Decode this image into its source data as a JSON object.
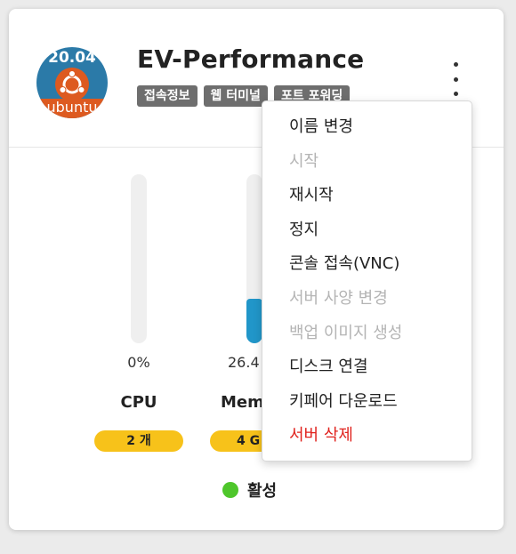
{
  "server": {
    "name": "EV-Performance",
    "os_version": "20.04",
    "os_name": "ubuntu",
    "tags": [
      "접속정보",
      "웹 터미널",
      "포트 포워딩"
    ]
  },
  "metrics": [
    {
      "name": "CPU",
      "percent_text": "0%",
      "usage": 0.0,
      "spec": "2 개"
    },
    {
      "name": "Mem",
      "percent_text": "26.4",
      "usage": 0.264,
      "spec": "4 G"
    }
  ],
  "status": {
    "text": "활성",
    "color": "#4ec62b"
  },
  "menu": {
    "items": [
      {
        "label": "이름 변경",
        "state": "enabled"
      },
      {
        "label": "시작",
        "state": "disabled"
      },
      {
        "label": "재시작",
        "state": "enabled"
      },
      {
        "label": "정지",
        "state": "enabled"
      },
      {
        "label": "콘솔 접속(VNC)",
        "state": "enabled"
      },
      {
        "label": "서버 사양 변경",
        "state": "disabled"
      },
      {
        "label": "백업 이미지 생성",
        "state": "disabled"
      },
      {
        "label": "디스크 연결",
        "state": "enabled"
      },
      {
        "label": "키페어 다운로드",
        "state": "enabled"
      },
      {
        "label": "서버 삭제",
        "state": "danger"
      }
    ]
  },
  "colors": {
    "accent_bar": "#2196c9",
    "spec_pill": "#f7c21a",
    "danger": "#e0211c",
    "tag_bg": "#6e6e6e"
  }
}
